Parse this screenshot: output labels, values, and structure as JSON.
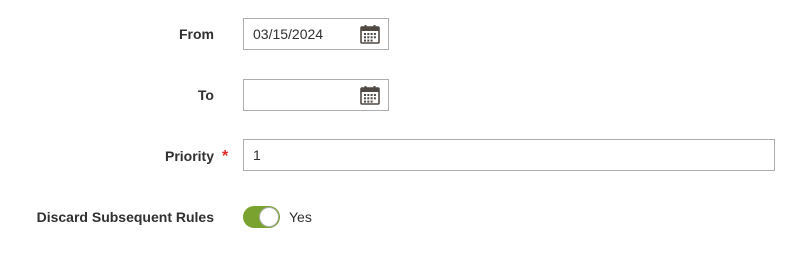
{
  "form": {
    "from": {
      "label": "From",
      "value": "03/15/2024",
      "calendar_icon": "calendar-icon"
    },
    "to": {
      "label": "To",
      "value": "",
      "calendar_icon": "calendar-icon"
    },
    "priority": {
      "label": "Priority",
      "required_mark": "*",
      "value": "1"
    },
    "discard_subsequent_rules": {
      "label": "Discard Subsequent Rules",
      "state_label": "Yes",
      "enabled": true
    }
  },
  "colors": {
    "toggle_on": "#79a22e",
    "required": "#e02b27",
    "border": "#adadad",
    "text": "#303030"
  }
}
